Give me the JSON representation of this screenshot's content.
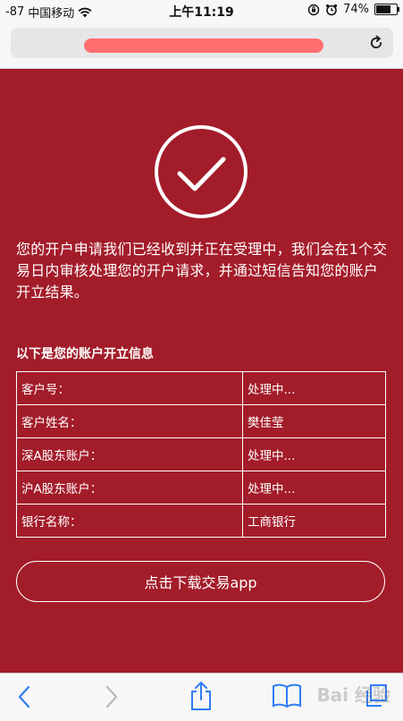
{
  "status_bar": {
    "signal": "-87",
    "carrier": "中国移动",
    "time": "上午11:19",
    "battery_text": "74%",
    "battery_level": 0.74
  },
  "message": "您的开户申请我们已经收到并正在受理中，我们会在1个交易日内审核处理您的开户请求，并通过短信告知您的账户开立结果。",
  "info_title": "以下是您的账户开立信息",
  "account_info": [
    {
      "label": "客户号：",
      "value": "处理中..."
    },
    {
      "label": "客户姓名：",
      "value": "樊佳莹"
    },
    {
      "label": "深A股东账户：",
      "value": "处理中..."
    },
    {
      "label": "沪A股东账户：",
      "value": "处理中..."
    },
    {
      "label": "银行名称：",
      "value": "工商银行"
    }
  ],
  "download_button": "点击下载交易app",
  "watermark": "Bai 经验",
  "colors": {
    "background": "#a31c2a",
    "text": "#ffffff",
    "redaction": "#ff6f6f",
    "ios_blue": "#2f7cf6"
  }
}
